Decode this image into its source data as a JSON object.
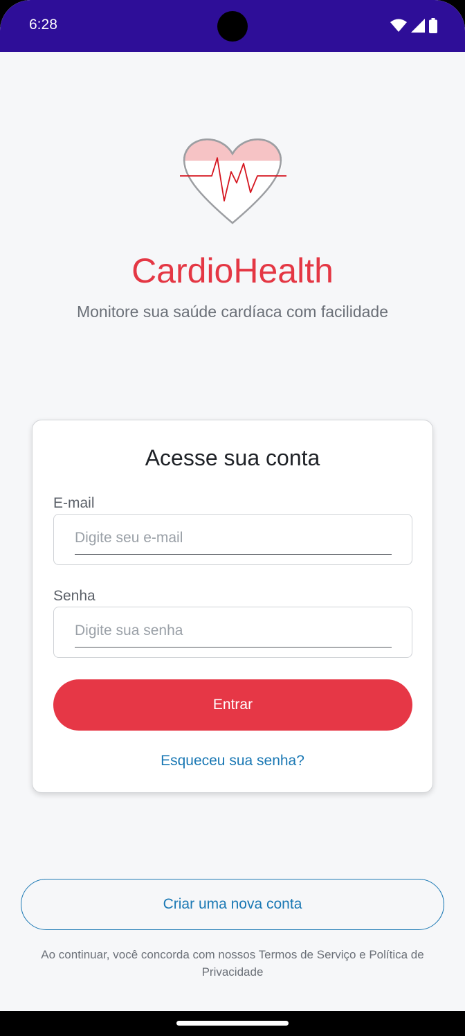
{
  "status_bar": {
    "time": "6:28",
    "icons": [
      "wifi-icon",
      "signal-icon",
      "battery-icon"
    ]
  },
  "branding": {
    "logo_icon": "heart-pulse-icon",
    "app_name": "CardioHealth",
    "tagline": "Monitore sua saúde cardíaca com facilidade"
  },
  "login_card": {
    "title": "Acesse sua conta",
    "email_label": "E-mail",
    "email_value": "",
    "email_placeholder": "Digite seu e-mail",
    "password_label": "Senha",
    "password_value": "",
    "password_placeholder": "Digite sua senha",
    "login_button": "Entrar",
    "forgot_link": "Esqueceu sua senha?"
  },
  "create_account_button": "Criar uma nova conta",
  "legal_text": "Ao continuar, você concorda com nossos Termos de Serviço e Política de Privacidade",
  "colors": {
    "status_bar": "#2e0e98",
    "brand_red": "#e63746",
    "link_blue": "#1a78b4",
    "background": "#f6f7f9"
  }
}
